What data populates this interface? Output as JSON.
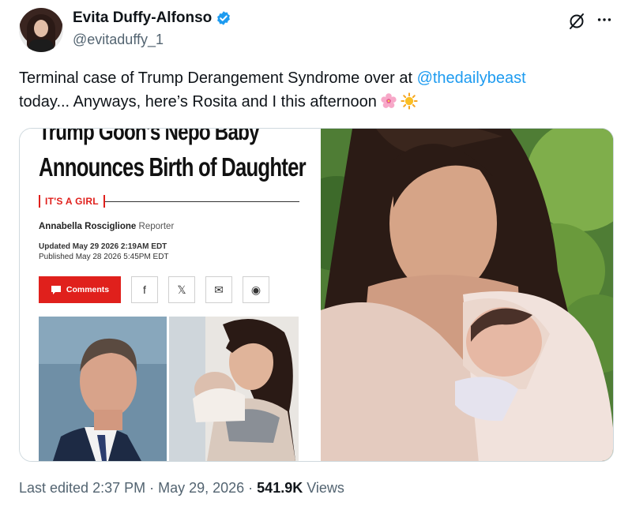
{
  "author": {
    "display_name": "Evita Duffy-Alfonso",
    "handle": "@evitaduffy_1",
    "verified": true
  },
  "tweet": {
    "text_before": "Terminal case of Trump Derangement Syndrome over at ",
    "mention": "@thedailybeast",
    "text_after": " today... Anyways, here’s Rosita and I this afternoon",
    "emojis": [
      "cherry-blossom",
      "sun"
    ]
  },
  "article": {
    "headline_top": "Trump Goon's Nepo Baby",
    "headline": "Announces Birth of Daughter",
    "kicker": "IT'S A GIRL",
    "author_name": "Annabella Rosciglione",
    "author_role": "Reporter",
    "updated": "Updated May 29 2026 2:19AM EDT",
    "published": "Published May 28 2026 5:45PM EDT",
    "comments_label": "Comments",
    "share_icons": [
      "facebook-icon",
      "x-icon",
      "mail-icon",
      "reddit-icon"
    ],
    "share_glyphs": [
      "f",
      "𝕏",
      "✉",
      "◉"
    ]
  },
  "footer": {
    "edited": "Last edited 2:37 PM · May 29, 2026 · ",
    "views_count": "541.9K",
    "views_label": " Views"
  },
  "colors": {
    "link": "#1d9bf0",
    "verified": "#1d9bf0",
    "beast_red": "#e0201c",
    "muted": "#536471"
  }
}
